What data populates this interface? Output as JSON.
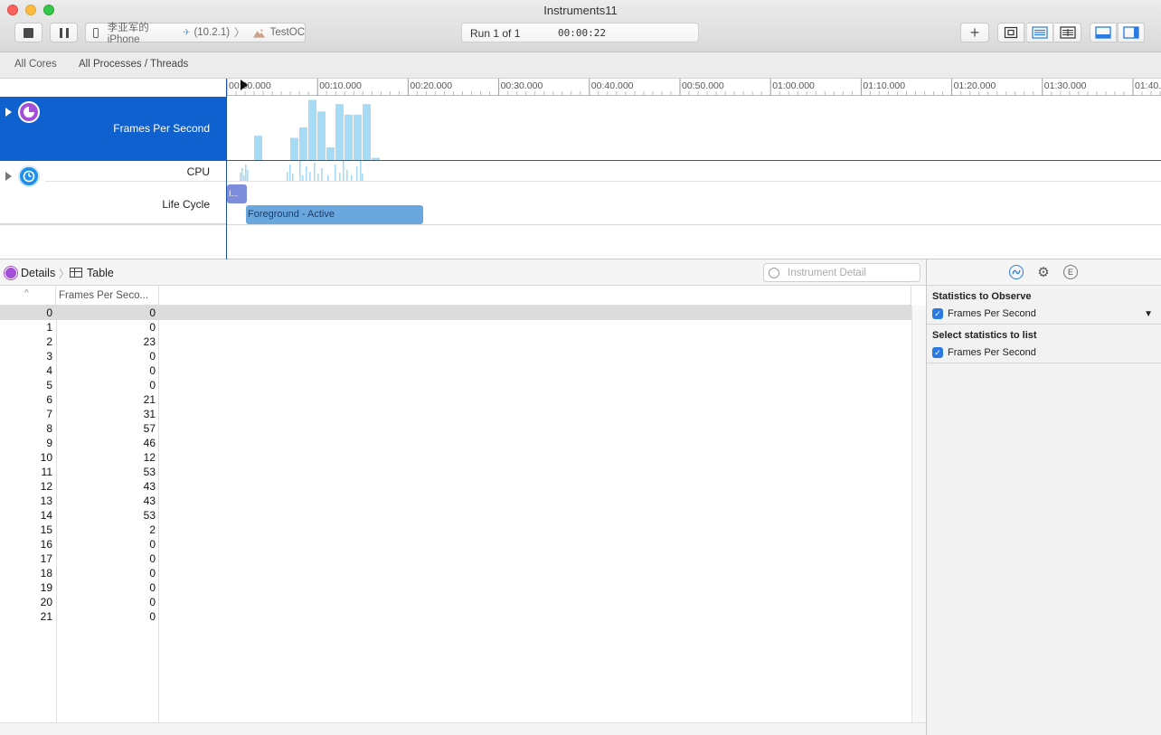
{
  "window": {
    "title": "Instruments11"
  },
  "toolbar": {
    "device_label": "李亚军的 iPhone",
    "os_version": "(10.2.1)",
    "app_name": "TestOC",
    "run_label": "Run 1 of 1",
    "elapsed_time": "00:00:22"
  },
  "scope_bar": {
    "all_cores": "All Cores",
    "all_processes": "All Processes / Threads"
  },
  "timeline": {
    "ruler_ticks": [
      "00:00.000",
      "00:10.000",
      "00:20.000",
      "00:30.000",
      "00:40.000",
      "00:50.000",
      "01:00.000",
      "01:10.000",
      "01:20.000",
      "01:30.000",
      "01:40.0"
    ],
    "tracks": {
      "fps": "Frames Per Second",
      "cpu": "CPU",
      "life_cycle": "Life Cycle"
    },
    "life_cycle_short": "I...",
    "life_cycle_state": "Foreground - Active",
    "fps_values": [
      0,
      0,
      23,
      0,
      0,
      0,
      21,
      31,
      57,
      46,
      12,
      53,
      43,
      43,
      53,
      2,
      0,
      0,
      0,
      0,
      0,
      0
    ],
    "accent_color": "#1061d0",
    "graph_color": "#a7daf4"
  },
  "details_bar": {
    "details": "Details",
    "table": "Table",
    "search_placeholder": "Instrument Detail"
  },
  "table": {
    "columns": [
      "",
      "Frames Per Seco..."
    ],
    "rows": [
      {
        "index": "0",
        "fps": "0"
      },
      {
        "index": "1",
        "fps": "0"
      },
      {
        "index": "2",
        "fps": "23"
      },
      {
        "index": "3",
        "fps": "0"
      },
      {
        "index": "4",
        "fps": "0"
      },
      {
        "index": "5",
        "fps": "0"
      },
      {
        "index": "6",
        "fps": "21"
      },
      {
        "index": "7",
        "fps": "31"
      },
      {
        "index": "8",
        "fps": "57"
      },
      {
        "index": "9",
        "fps": "46"
      },
      {
        "index": "10",
        "fps": "12"
      },
      {
        "index": "11",
        "fps": "53"
      },
      {
        "index": "12",
        "fps": "43"
      },
      {
        "index": "13",
        "fps": "43"
      },
      {
        "index": "14",
        "fps": "53"
      },
      {
        "index": "15",
        "fps": "2"
      },
      {
        "index": "16",
        "fps": "0"
      },
      {
        "index": "17",
        "fps": "0"
      },
      {
        "index": "18",
        "fps": "0"
      },
      {
        "index": "19",
        "fps": "0"
      },
      {
        "index": "20",
        "fps": "0"
      },
      {
        "index": "21",
        "fps": "0"
      }
    ]
  },
  "inspector": {
    "observe_title": "Statistics to Observe",
    "observe_item": "Frames Per Second",
    "list_title": "Select statistics to list",
    "list_item": "Frames Per Second"
  }
}
